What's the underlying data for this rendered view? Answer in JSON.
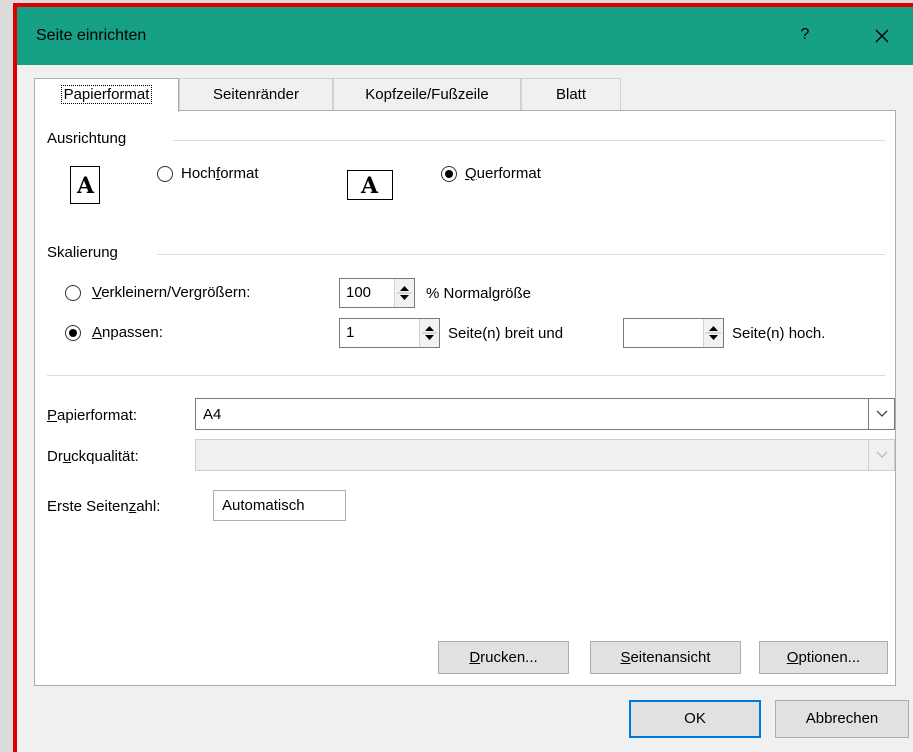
{
  "window": {
    "title": "Seite einrichten",
    "help_label": "?",
    "close_icon": "close-icon",
    "title_bar_color": "#16a085"
  },
  "tabs": [
    {
      "label": "Papierformat",
      "active": true
    },
    {
      "label": "Seitenränder",
      "active": false
    },
    {
      "label": "Kopfzeile/Fußzeile",
      "active": false
    },
    {
      "label": "Blatt",
      "active": false
    }
  ],
  "orientation": {
    "group_label": "Ausrichtung",
    "icon_letter": "A",
    "portrait": {
      "label_pre": "Hoch",
      "label_key": "f",
      "label_post": "ormat",
      "checked": false
    },
    "landscape": {
      "label_pre": "",
      "label_key": "Q",
      "label_post": "uerformat",
      "checked": true
    }
  },
  "scaling": {
    "group_label": "Skalierung",
    "adjust": {
      "label_pre": "",
      "label_key": "V",
      "label_post": "erkleinern/Vergrößern:",
      "checked": false,
      "value": "100",
      "suffix": "% Normalgröße"
    },
    "fit": {
      "label_pre": "",
      "label_key": "A",
      "label_post": "npassen:",
      "checked": true,
      "wide_value": "1",
      "wide_suffix": "Seite(n) breit und",
      "tall_value": "",
      "tall_suffix": "Seite(n) hoch."
    }
  },
  "paper": {
    "paper_size": {
      "label_pre": "",
      "label_key": "P",
      "label_post": "apierformat:",
      "value": "A4"
    },
    "print_quality": {
      "label_pre": "Dr",
      "label_key": "u",
      "label_post": "ckqualität:",
      "value": ""
    },
    "first_page": {
      "label_pre": "Erste Seiten",
      "label_key": "z",
      "label_post": "ahl:",
      "value": "Automatisch"
    }
  },
  "page_buttons": [
    {
      "pre": "",
      "key": "D",
      "post": "rucken..."
    },
    {
      "pre": "",
      "key": "S",
      "post": "eitenansicht"
    },
    {
      "pre": "",
      "key": "O",
      "post": "ptionen..."
    }
  ],
  "dialog_buttons": {
    "ok": "OK",
    "cancel": "Abbrechen"
  }
}
